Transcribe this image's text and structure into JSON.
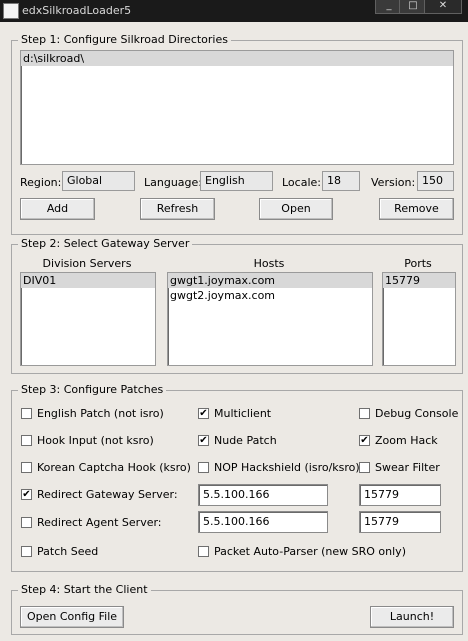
{
  "window": {
    "title": "edxSilkroadLoader5",
    "min": "_",
    "max": "□",
    "close": "✕"
  },
  "step1": {
    "legend": "Step 1: Configure Silkroad Directories",
    "directories": [
      "d:\\silkroad\\"
    ],
    "region_label": "Region:",
    "region_value": "Global",
    "language_label": "Language:",
    "language_value": "English",
    "locale_label": "Locale:",
    "locale_value": "18",
    "version_label": "Version:",
    "version_value": "150",
    "buttons": {
      "add": "Add",
      "refresh": "Refresh",
      "open": "Open",
      "remove": "Remove"
    }
  },
  "step2": {
    "legend": "Step 2: Select Gateway Server",
    "division_header": "Division Servers",
    "hosts_header": "Hosts",
    "ports_header": "Ports",
    "divisions": [
      "DIV01"
    ],
    "hosts": [
      "gwgt1.joymax.com",
      "gwgt2.joymax.com"
    ],
    "ports": [
      "15779"
    ]
  },
  "step3": {
    "legend": "Step 3: Configure Patches",
    "english_patch": {
      "label": "English Patch (not isro)",
      "checked": false
    },
    "multiclient": {
      "label": "Multiclient",
      "checked": true
    },
    "debug_console": {
      "label": "Debug Console",
      "checked": false
    },
    "hook_input": {
      "label": "Hook Input (not ksro)",
      "checked": false
    },
    "nude_patch": {
      "label": "Nude Patch",
      "checked": true
    },
    "zoom_hack": {
      "label": "Zoom Hack",
      "checked": true
    },
    "korean_captcha": {
      "label": "Korean Captcha Hook (ksro)",
      "checked": false
    },
    "nop_hackshield": {
      "label": "NOP Hackshield (isro/ksro)",
      "checked": false
    },
    "swear_filter": {
      "label": "Swear Filter",
      "checked": false
    },
    "redirect_gateway": {
      "label": "Redirect Gateway Server:",
      "checked": true,
      "ip": "5.5.100.166",
      "port": "15779"
    },
    "redirect_agent": {
      "label": "Redirect Agent Server:",
      "checked": false,
      "ip": "5.5.100.166",
      "port": "15779"
    },
    "patch_seed": {
      "label": "Patch Seed",
      "checked": false
    },
    "packet_parser": {
      "label": "Packet Auto-Parser (new SRO only)",
      "checked": false
    },
    "check_mark": "✔"
  },
  "step4": {
    "legend": "Step 4: Start the Client",
    "open_config": "Open Config File",
    "launch": "Launch!"
  }
}
